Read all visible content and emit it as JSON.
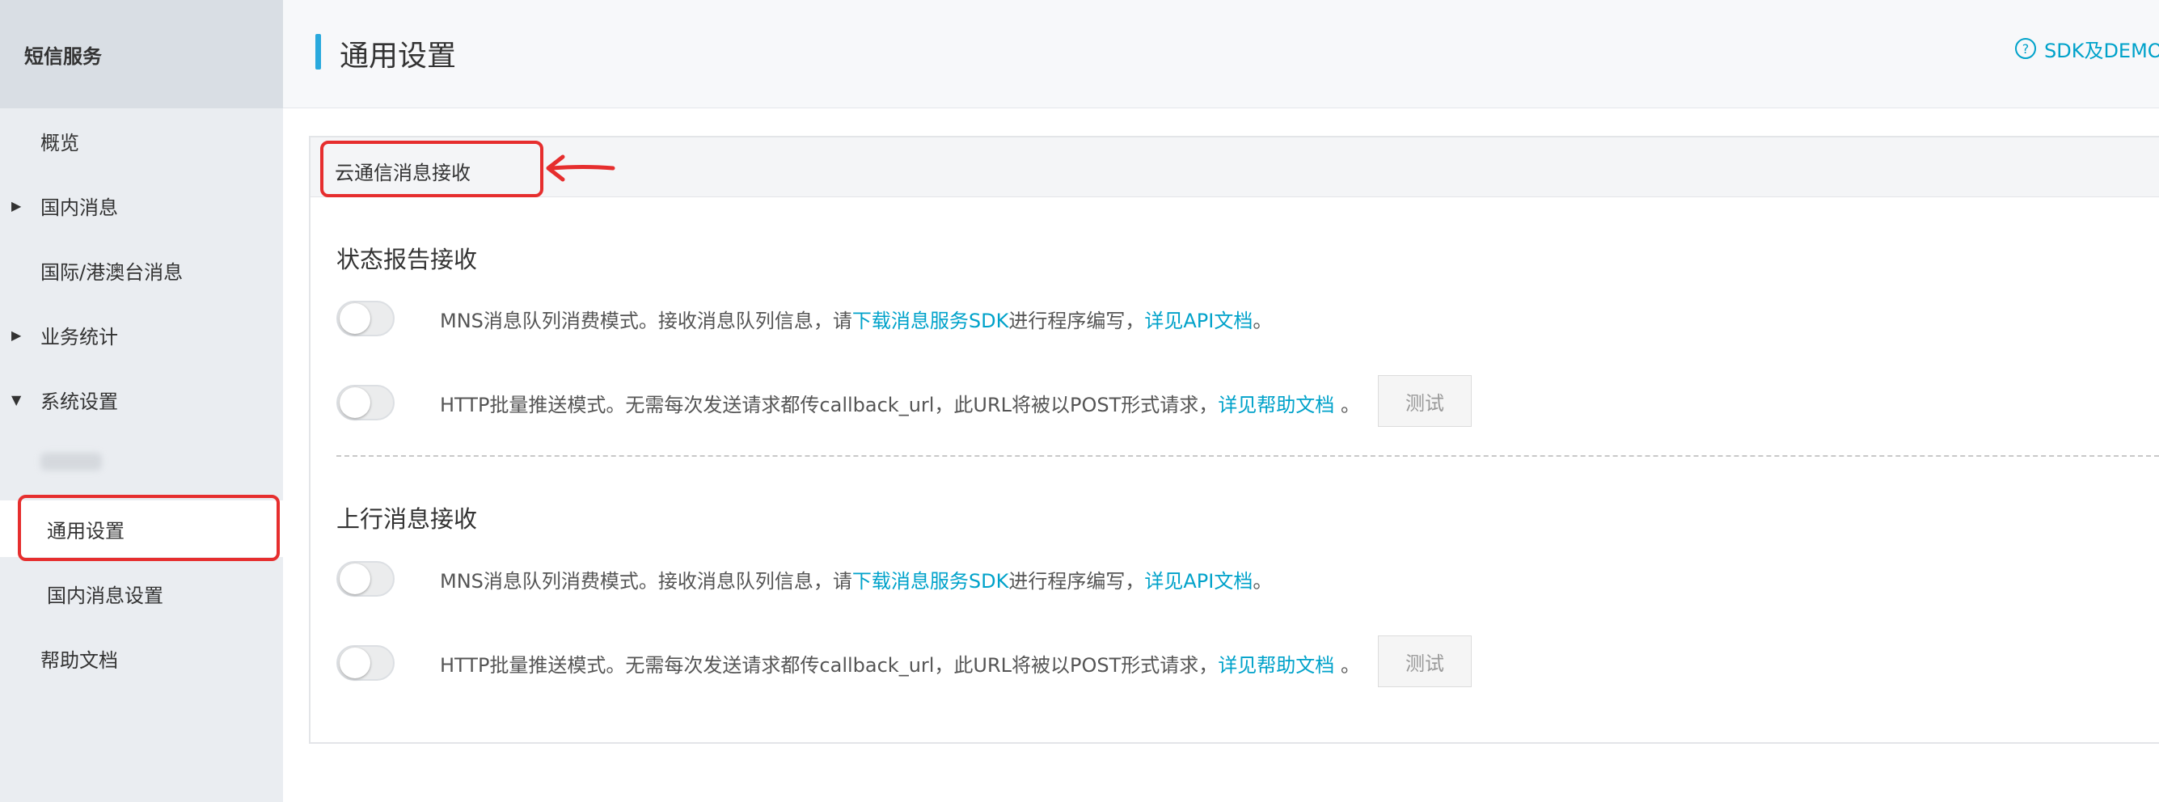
{
  "sidebar": {
    "title": "短信服务",
    "items": [
      {
        "label": "概览"
      },
      {
        "label": "国内消息",
        "caret": "▶"
      },
      {
        "label": "国际/港澳台消息"
      },
      {
        "label": "业务统计",
        "caret": "▶"
      },
      {
        "label": "系统设置",
        "caret": "▼"
      },
      {
        "label": "通用设置"
      },
      {
        "label": "国内消息设置"
      },
      {
        "label": "帮助文档"
      }
    ]
  },
  "header": {
    "title": "通用设置",
    "sdk_link": "SDK及DEMO",
    "help_icon": "?"
  },
  "panel": {
    "header": "云通信消息接收",
    "sections": [
      {
        "title": "状态报告接收",
        "rows": [
          {
            "text_before": "MNS消息队列消费模式。接收消息队列信息，请",
            "link1": "下载消息服务SDK",
            "text_middle": "进行程序编写，",
            "link2": "详见API文档",
            "text_after": "。"
          },
          {
            "text_before": "HTTP批量推送模式。无需每次发送请求都传callback_url，此URL将被以POST形式请求，",
            "link1": "详见帮助文档",
            "text_after": " 。",
            "button": "测试"
          }
        ]
      },
      {
        "title": "上行消息接收",
        "rows": [
          {
            "text_before": "MNS消息队列消费模式。接收消息队列信息，请",
            "link1": "下载消息服务SDK",
            "text_middle": "进行程序编写，",
            "link2": "详见API文档",
            "text_after": "。"
          },
          {
            "text_before": "HTTP批量推送模式。无需每次发送请求都传callback_url，此URL将被以POST形式请求，",
            "link1": "详见帮助文档",
            "text_after": " 。",
            "button": "测试"
          }
        ]
      }
    ]
  },
  "colors": {
    "accent": "#29a9dd",
    "link": "#00a2ca",
    "annotation": "#e62e2e",
    "sidebar_bg": "#eaedf1"
  }
}
